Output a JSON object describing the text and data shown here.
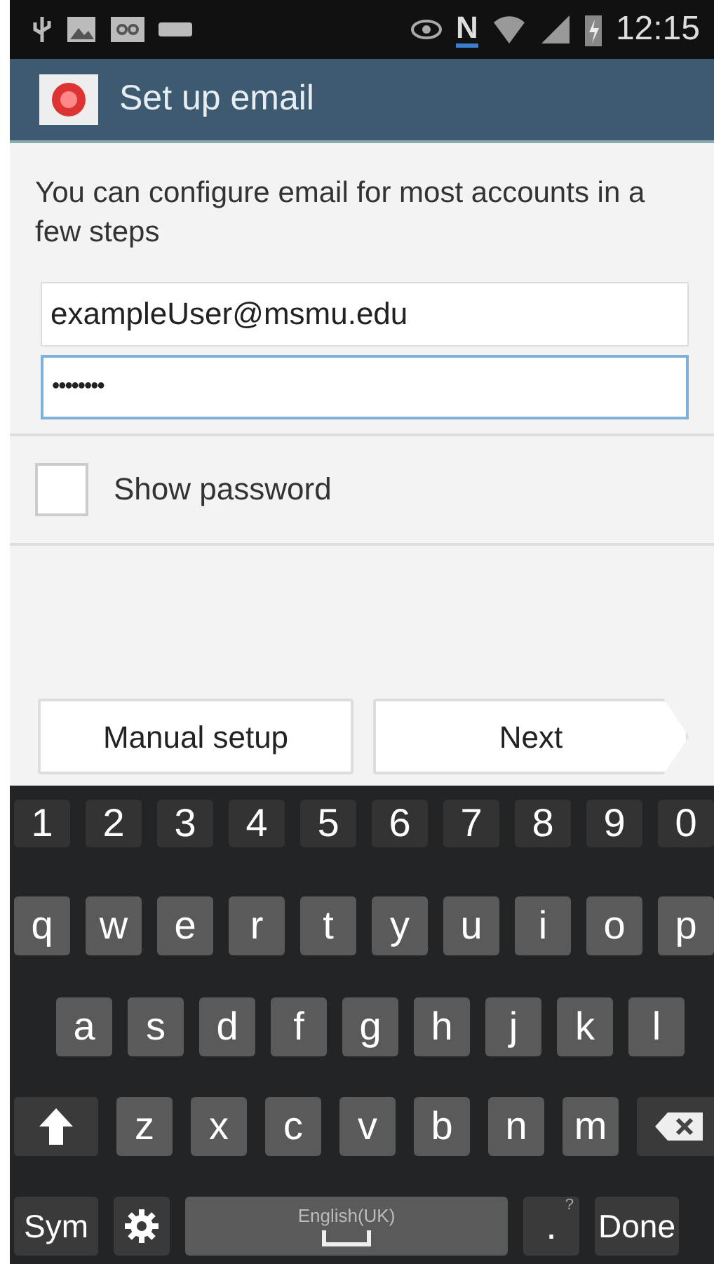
{
  "status_bar": {
    "nfc": "N",
    "time": "12:15"
  },
  "action_bar": {
    "title": "Set up email"
  },
  "intro": "You can configure email for most accounts in a few steps",
  "fields": [
    {
      "kind": "email",
      "value": "exampleUser@msmu.edu",
      "focused": false
    },
    {
      "kind": "password",
      "value": "••••••••",
      "focused": true
    }
  ],
  "show_password": {
    "label": "Show password",
    "checked": false
  },
  "buttons": [
    {
      "kind": "plain",
      "label": "Manual setup"
    },
    {
      "kind": "next",
      "label": "Next"
    }
  ],
  "keyboard": {
    "rows": [
      {
        "keys": [
          {
            "kind": "char",
            "label": "1"
          },
          {
            "kind": "char",
            "label": "2"
          },
          {
            "kind": "char",
            "label": "3"
          },
          {
            "kind": "char",
            "label": "4"
          },
          {
            "kind": "char",
            "label": "5"
          },
          {
            "kind": "char",
            "label": "6"
          },
          {
            "kind": "char",
            "label": "7"
          },
          {
            "kind": "char",
            "label": "8"
          },
          {
            "kind": "char",
            "label": "9"
          },
          {
            "kind": "char",
            "label": "0"
          }
        ]
      },
      {
        "keys": [
          {
            "kind": "char",
            "label": "q"
          },
          {
            "kind": "char",
            "label": "w"
          },
          {
            "kind": "char",
            "label": "e"
          },
          {
            "kind": "char",
            "label": "r"
          },
          {
            "kind": "char",
            "label": "t"
          },
          {
            "kind": "char",
            "label": "y"
          },
          {
            "kind": "char",
            "label": "u"
          },
          {
            "kind": "char",
            "label": "i"
          },
          {
            "kind": "char",
            "label": "o"
          },
          {
            "kind": "char",
            "label": "p"
          }
        ]
      },
      {
        "keys": [
          {
            "kind": "char",
            "label": "a"
          },
          {
            "kind": "char",
            "label": "s"
          },
          {
            "kind": "char",
            "label": "d"
          },
          {
            "kind": "char",
            "label": "f"
          },
          {
            "kind": "char",
            "label": "g"
          },
          {
            "kind": "char",
            "label": "h"
          },
          {
            "kind": "char",
            "label": "j"
          },
          {
            "kind": "char",
            "label": "k"
          },
          {
            "kind": "char",
            "label": "l"
          }
        ]
      },
      {
        "keys": [
          {
            "kind": "shift"
          },
          {
            "kind": "char",
            "label": "z"
          },
          {
            "kind": "char",
            "label": "x"
          },
          {
            "kind": "char",
            "label": "c"
          },
          {
            "kind": "char",
            "label": "v"
          },
          {
            "kind": "char",
            "label": "b"
          },
          {
            "kind": "char",
            "label": "n"
          },
          {
            "kind": "char",
            "label": "m"
          },
          {
            "kind": "backspace"
          }
        ]
      },
      {
        "keys": [
          {
            "kind": "sym",
            "label": "Sym"
          },
          {
            "kind": "settings"
          },
          {
            "kind": "space",
            "label": "English(UK)"
          },
          {
            "kind": "period",
            "label": ".",
            "hint": "?"
          },
          {
            "kind": "done",
            "label": "Done"
          }
        ]
      }
    ]
  }
}
